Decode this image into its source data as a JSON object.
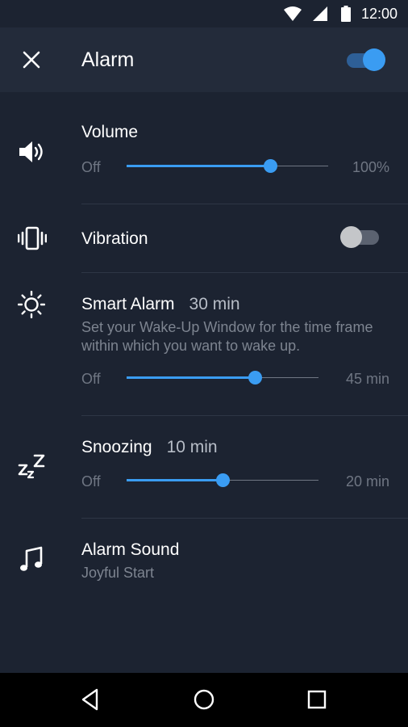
{
  "status_bar": {
    "time": "12:00",
    "icons": [
      "wifi-icon",
      "cell-signal-icon",
      "battery-icon"
    ]
  },
  "header": {
    "title": "Alarm",
    "enabled": true,
    "close_icon": "close-icon"
  },
  "volume": {
    "title": "Volume",
    "min_label": "Off",
    "max_label": "100%",
    "level": 0.71,
    "icon": "volume-icon"
  },
  "vibration": {
    "title": "Vibration",
    "enabled": false,
    "icon": "vibration-icon"
  },
  "smart_alarm": {
    "title": "Smart Alarm",
    "value": "30 min",
    "description": "Set your Wake-Up Window for the time frame within which you want to wake up.",
    "min_label": "Off",
    "max_label": "45 min",
    "level": 0.67,
    "icon": "sun-icon"
  },
  "snoozing": {
    "title": "Snoozing",
    "value": "10 min",
    "min_label": "Off",
    "max_label": "20 min",
    "level": 0.5,
    "icon": "snooze-icon"
  },
  "alarm_sound": {
    "title": "Alarm Sound",
    "value": "Joyful Start",
    "icon": "music-note-icon"
  },
  "nav": [
    "back-icon",
    "home-icon",
    "recents-icon"
  ],
  "colors": {
    "background": "#1c2331",
    "header": "#232b3a",
    "accent": "#3a9cf2",
    "muted": "#6f7683"
  }
}
